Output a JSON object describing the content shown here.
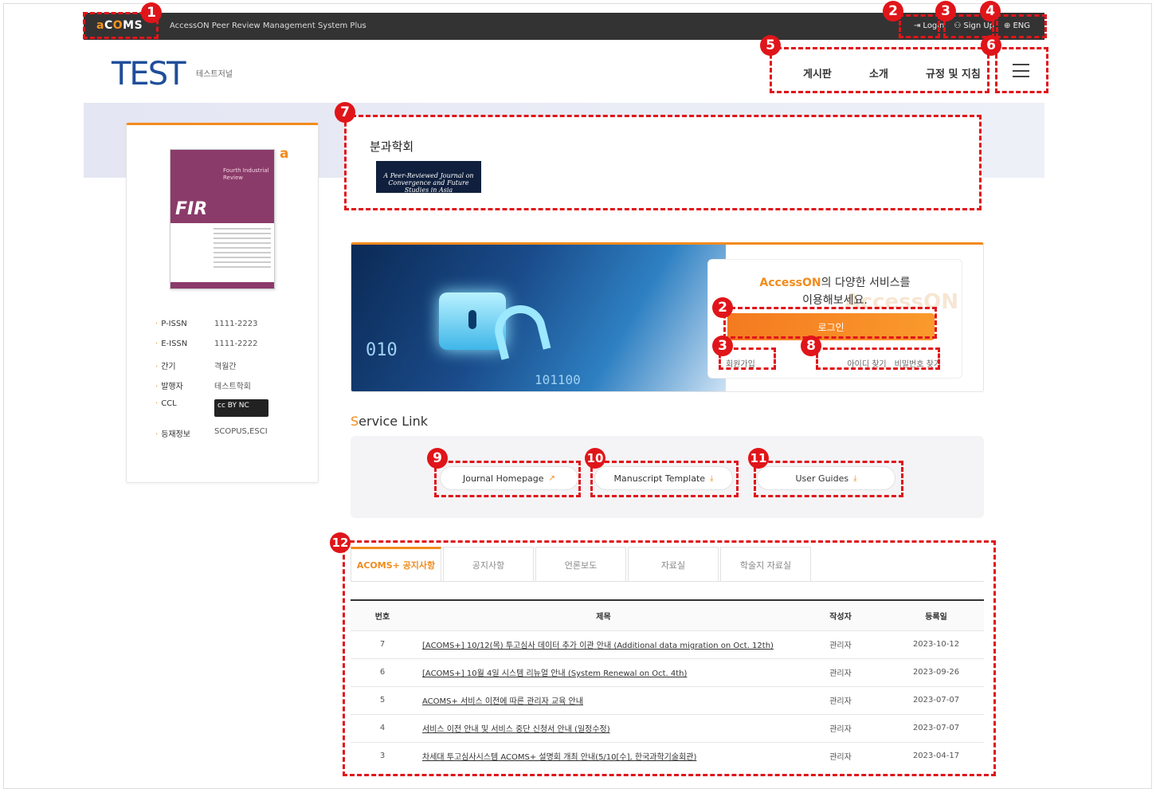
{
  "topbar": {
    "logo_a": "a",
    "logo_co": "C",
    "logo_o": "O",
    "logo_ms": "MS",
    "system_name": "AccessON Peer Review Management System Plus",
    "login": "Login",
    "signup": "Sign Up",
    "language": "ENG"
  },
  "header": {
    "brand": "TEST",
    "brand_sub": "테스트저널",
    "nav": [
      "게시판",
      "소개",
      "규정 및 지침"
    ]
  },
  "journal": {
    "cover_title": "Fourth Industrial Review",
    "cover_logo": "FIR",
    "oa_icon": "a",
    "info": [
      {
        "key": "P-ISSN",
        "value": "1111-2223"
      },
      {
        "key": "E-ISSN",
        "value": "1111-2222"
      },
      {
        "key": "간기",
        "value": "격월간"
      },
      {
        "key": "발행자",
        "value": "테스트학회"
      },
      {
        "key": "CCL",
        "value": "cc BY NC"
      },
      {
        "key": "등재정보",
        "value": "SCOPUS,ESCI"
      }
    ]
  },
  "association": {
    "title": "분과학회",
    "journal_logo": "A Peer-Reviewed Journal on Convergence and Future Studies in Asia"
  },
  "login_panel": {
    "headline_brand": "AccessON",
    "headline_rest": "의 다양한 서비스를",
    "headline_line2": "이용해보세요.",
    "watermark": "AccessON",
    "login_button": "로그인",
    "register": "회원가입",
    "find_id": "아이디 찾기",
    "find_pw": "비밀번호 찾기",
    "bg_text_1": "010",
    "bg_text_2": "101100"
  },
  "service": {
    "title_first": "S",
    "title_rest": "ervice Link",
    "buttons": [
      "Journal Homepage",
      "Manuscript Template",
      "User Guides"
    ]
  },
  "notices": {
    "tabs": [
      "ACOMS+ 공지사항",
      "공지사항",
      "언론보도",
      "자료실",
      "학술지 자료실"
    ],
    "columns": [
      "번호",
      "제목",
      "작성자",
      "등록일"
    ],
    "rows": [
      {
        "no": "7",
        "title": "[ACOMS+] 10/12(목) 투고심사 데이터 추가 이관 안내 (Additional data migration on Oct. 12th)",
        "author": "관리자",
        "date": "2023-10-12"
      },
      {
        "no": "6",
        "title": "[ACOMS+] 10월 4일 시스템 리뉴얼 안내 (System Renewal on Oct. 4th)",
        "author": "관리자",
        "date": "2023-09-26"
      },
      {
        "no": "5",
        "title": "ACOMS+ 서비스 이전에 따른 관리자 교육 안내",
        "author": "관리자",
        "date": "2023-07-07"
      },
      {
        "no": "4",
        "title": "서비스 이전 안내 및 서비스 중단 신청서 안내 (일정수정)",
        "author": "관리자",
        "date": "2023-07-07"
      },
      {
        "no": "3",
        "title": "차세대 투고심사시스템 ACOMS+ 설명회 개최 안내(5/10[수], 한국과학기술회관)",
        "author": "관리자",
        "date": "2023-04-17"
      }
    ]
  },
  "annotations": [
    "1",
    "2",
    "3",
    "4",
    "5",
    "6",
    "7",
    "2",
    "3",
    "8",
    "9",
    "10",
    "11",
    "12"
  ],
  "colors": {
    "accent": "#f28b1d",
    "annotation": "#e0151a",
    "topbar": "#333333",
    "brand": "#1f4e9a"
  }
}
